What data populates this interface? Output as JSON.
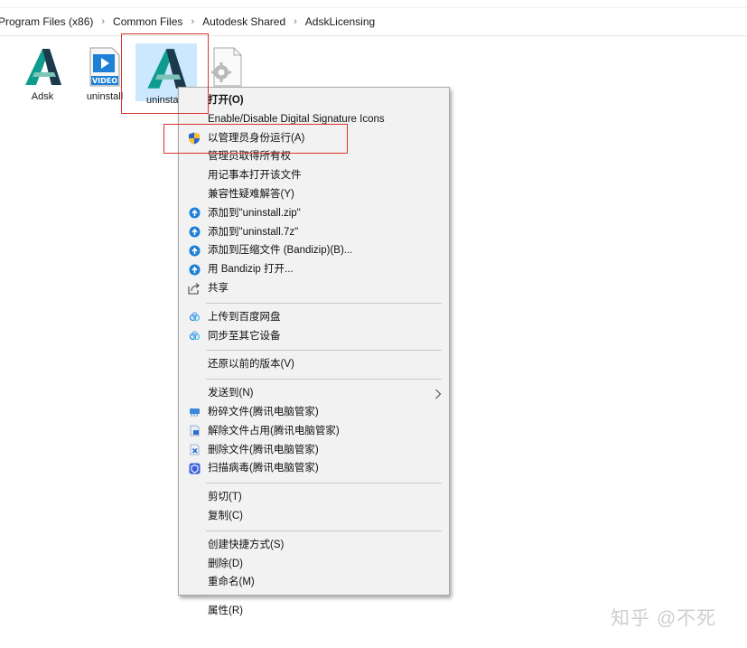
{
  "breadcrumb": {
    "items": [
      "Program Files (x86)",
      "Common Files",
      "Autodesk Shared",
      "AdskLicensing"
    ],
    "separator": "›"
  },
  "files": {
    "adsk": {
      "label": "Adsk"
    },
    "video": {
      "label": "uninstall",
      "badge": "VIDEO"
    },
    "uninstall": {
      "label": "uninstall"
    },
    "gear": {
      "label": ""
    }
  },
  "context_menu": {
    "open": "打开(O)",
    "sig_icons": "Enable/Disable Digital Signature Icons",
    "run_as_admin": "以管理员身份运行(A)",
    "take_ownership": "管理员取得所有权",
    "open_notepad": "用记事本打开该文件",
    "troubleshoot": "兼容性疑难解答(Y)",
    "add_zip": "添加到\"uninstall.zip\"",
    "add_7z": "添加到\"uninstall.7z\"",
    "add_archive": "添加到压缩文件 (Bandizip)(B)...",
    "open_bandizip": "用 Bandizip 打开...",
    "share": "共享",
    "upload_baidu": "上传到百度网盘",
    "sync_devices": "同步至其它设备",
    "restore_versions": "还原以前的版本(V)",
    "send_to": "发送到(N)",
    "shred": "粉碎文件(腾讯电脑管家)",
    "unlock": "解除文件占用(腾讯电脑管家)",
    "delete_tx": "删除文件(腾讯电脑管家)",
    "scan_virus": "扫描病毒(腾讯电脑管家)",
    "cut": "剪切(T)",
    "copy": "复制(C)",
    "create_shortcut": "创建快捷方式(S)",
    "delete": "删除(D)",
    "rename": "重命名(M)",
    "properties": "属性(R)"
  },
  "watermark": "知乎 @不死",
  "colors": {
    "accent_red": "#d9342b",
    "selection": "#cce8ff",
    "bandizip_blue": "#1e7fd6",
    "autodesk_teal": "#0f9b8e"
  },
  "icons": [
    "autodesk-icon",
    "video-file-icon",
    "gear-file-icon",
    "uac-shield-icon",
    "bandizip-icon",
    "share-icon",
    "baidu-cloud-icon",
    "shred-icon",
    "unlock-icon",
    "delete-file-icon",
    "virus-scan-icon",
    "chevron-right-icon"
  ]
}
